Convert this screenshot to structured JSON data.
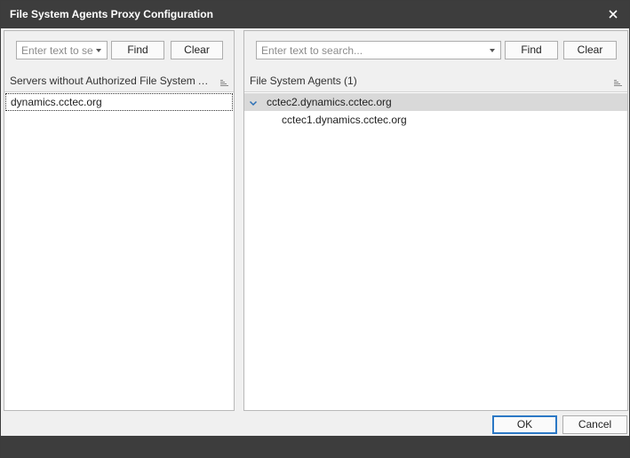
{
  "dialog": {
    "title": "File System Agents Proxy Configuration",
    "close_icon": "close-icon"
  },
  "left_panel": {
    "search": {
      "placeholder": "Enter text to se",
      "value": ""
    },
    "find_label": "Find",
    "clear_label": "Clear",
    "column_header": "Servers without Authorized File System Age...",
    "items": [
      {
        "label": "dynamics.cctec.org",
        "focused": true
      }
    ]
  },
  "right_panel": {
    "search": {
      "placeholder": "Enter text to search...",
      "value": ""
    },
    "find_label": "Find",
    "clear_label": "Clear",
    "column_header": "File System Agents (1)",
    "tree": {
      "group_label": "cctec2.dynamics.cctec.org",
      "expanded": true,
      "children": [
        "cctec1.dynamics.cctec.org"
      ]
    }
  },
  "footer": {
    "ok_label": "OK",
    "cancel_label": "Cancel"
  },
  "colors": {
    "titlebar": "#3d3d3d",
    "selection": "#d9d9d9",
    "ok_border": "#2b78c5",
    "expand_arrow": "#2b6fb5"
  }
}
